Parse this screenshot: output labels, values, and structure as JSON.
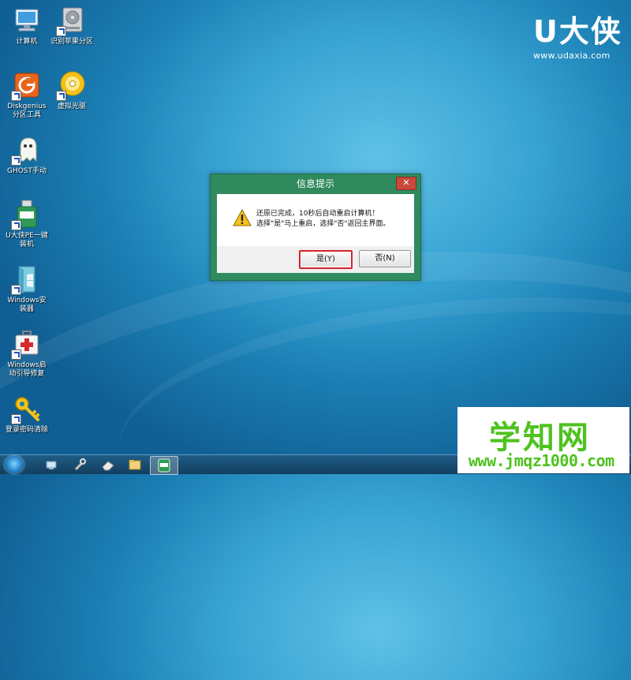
{
  "desktop": {
    "icons": [
      {
        "label": "计算机"
      },
      {
        "label": "识别苹果分区"
      },
      {
        "label": "Diskgenius\n分区工具"
      },
      {
        "label": "虚拟光驱"
      },
      {
        "label": "GHOST手动"
      },
      {
        "label": "U大侠PE一键\n装机"
      },
      {
        "label": "Windows安\n装器"
      },
      {
        "label": "Windows启\n动引导修复"
      },
      {
        "label": "登录密码清除"
      }
    ]
  },
  "brand": {
    "name": "U大侠",
    "url": "www.udaxia.com"
  },
  "dialog": {
    "title": "信息提示",
    "close_label": "✕",
    "message_line1": "还原已完成，10秒后自动重启计算机！",
    "message_line2": "选择\"是\"马上重启，选择\"否\"返回主界面。",
    "yes_label": "是(Y)",
    "no_label": "否(N)"
  },
  "taskbar": {
    "active_app": "U大侠"
  },
  "watermark": {
    "line1": "学知网",
    "line2": "www.jmqz1000.com"
  },
  "colors": {
    "dialog_frame": "#2f8a5e",
    "focus_border": "#d0262a",
    "watermark_green": "#4ec21e"
  }
}
